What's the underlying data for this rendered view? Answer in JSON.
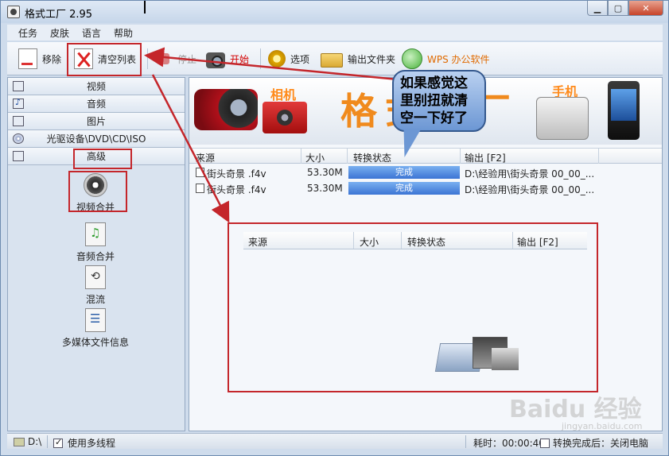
{
  "window": {
    "title": "格式工厂 2.95"
  },
  "menu": [
    "任务",
    "皮肤",
    "语言",
    "帮助"
  ],
  "toolbar": {
    "remove": "移除",
    "clear_list": "清空列表",
    "stop": "停止",
    "start": "开始",
    "options": "选项",
    "output_folder": "输出文件夹",
    "wps": "WPS 办公软件"
  },
  "sidebar": {
    "categories": [
      "视频",
      "音频",
      "图片",
      "光驱设备\\DVD\\CD\\ISO",
      "高级"
    ],
    "tools": [
      "视频合并",
      "音频合并",
      "混流",
      "多媒体文件信息"
    ]
  },
  "banner": {
    "camera_label": "相机",
    "phone_label": "手机",
    "title": "格式工厂"
  },
  "grid": {
    "columns": [
      "来源",
      "大小",
      "转换状态",
      "输出 [F2]"
    ],
    "rows": [
      {
        "source": "街头奇景 .f4v",
        "size": "53.30M",
        "status": "完成",
        "output": "D:\\经验用\\街头奇景  00_00_..."
      },
      {
        "source": "街头奇景 .f4v",
        "size": "53.30M",
        "status": "完成",
        "output": "D:\\经验用\\街头奇景  00_00_..."
      }
    ]
  },
  "annotation": {
    "callout_text": "如果感觉这里别扭就清空一下好了",
    "empty_grid_columns": [
      "来源",
      "大小",
      "转换状态",
      "输出 [F2]"
    ]
  },
  "statusbar": {
    "drive": "D:\\",
    "multithread_label": "使用多线程",
    "multithread_checked": true,
    "elapsed": "耗时：00:00:40",
    "after_finish": "转换完成后：关闭电脑"
  },
  "watermark": {
    "main": "Baidu 经验",
    "sub": "jingyan.baidu.com"
  },
  "colors": {
    "accent_red": "#c4262b",
    "status_blue": "#3b74d4",
    "banner_orange": "#f08a1d"
  }
}
